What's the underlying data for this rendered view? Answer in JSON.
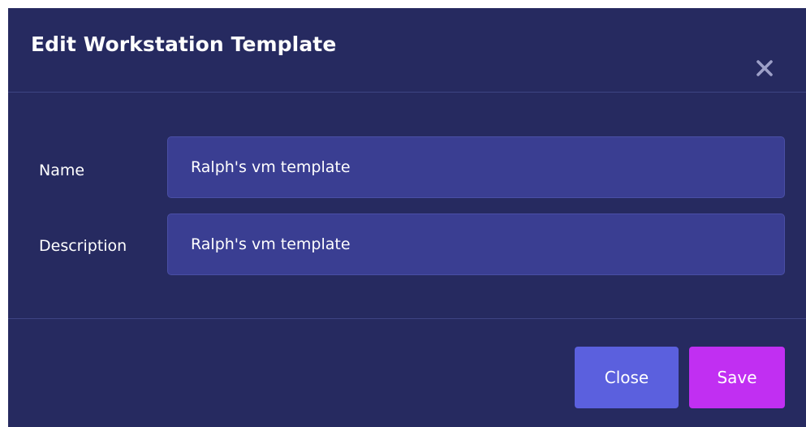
{
  "dialog": {
    "title": "Edit Workstation Template",
    "close_icon": "close-icon"
  },
  "form": {
    "name": {
      "label": "Name",
      "value": "Ralph's vm template"
    },
    "description": {
      "label": "Description",
      "value": "Ralph's vm template"
    }
  },
  "footer": {
    "close_label": "Close",
    "save_label": "Save"
  },
  "colors": {
    "background": "#262a60",
    "field": "#3a3e92",
    "close_button": "#5b60de",
    "save_button": "#c12ff2",
    "text": "#ffffff"
  }
}
